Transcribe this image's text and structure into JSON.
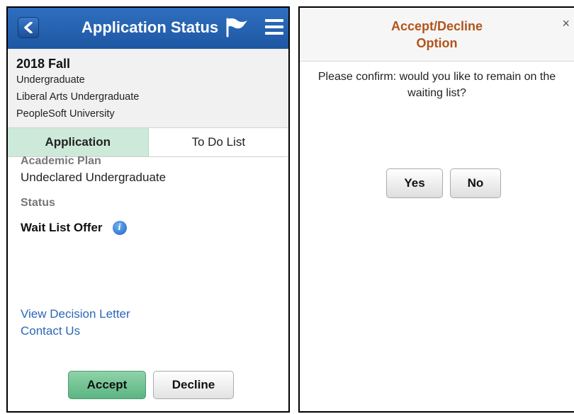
{
  "left": {
    "header": {
      "title": "Application Status"
    },
    "term": {
      "title": "2018 Fall",
      "career": "Undergraduate",
      "program": "Liberal Arts Undergraduate",
      "institution": "PeopleSoft University"
    },
    "tabs": [
      {
        "label": "Application",
        "active": true
      },
      {
        "label": "To Do List",
        "active": false
      }
    ],
    "content": {
      "plan_label": "Academic Plan",
      "plan_value": "Undeclared Undergraduate",
      "status_label": "Status",
      "status_value": "Wait List Offer",
      "info_glyph": "i",
      "links": {
        "view_decision_letter": "View Decision Letter",
        "contact_us": "Contact Us"
      }
    },
    "buttons": {
      "accept": "Accept",
      "decline": "Decline"
    }
  },
  "right": {
    "modal": {
      "title_line1": "Accept/Decline",
      "title_line2": "Option",
      "close_glyph": "×",
      "message": "Please confirm: would you like to remain on the waiting list?",
      "yes": "Yes",
      "no": "No"
    }
  },
  "colors": {
    "header_blue": "#2f6fbf",
    "active_tab": "#cde9d9",
    "accept_green": "#6fc292",
    "link_blue": "#2b66b8",
    "modal_title": "#b2541a"
  },
  "icons": [
    "back-icon",
    "flag-icon",
    "menu-icon",
    "info-icon",
    "close-icon"
  ]
}
